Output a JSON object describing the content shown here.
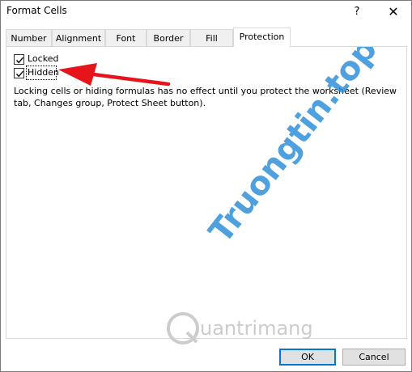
{
  "window": {
    "title": "Format Cells",
    "help_label": "?",
    "close_label": "✕"
  },
  "tabs": [
    {
      "label": "Number",
      "active": false
    },
    {
      "label": "Alignment",
      "active": false
    },
    {
      "label": "Font",
      "active": false
    },
    {
      "label": "Border",
      "active": false
    },
    {
      "label": "Fill",
      "active": false
    },
    {
      "label": "Protection",
      "active": true
    }
  ],
  "protection": {
    "locked": {
      "label": "Locked",
      "checked": true
    },
    "hidden": {
      "label": "Hidden",
      "checked": true
    },
    "info_text": "Locking cells or hiding formulas has no effect until you protect the worksheet (Review tab, Changes group, Protect Sheet button)."
  },
  "buttons": {
    "ok_label": "OK",
    "cancel_label": "Cancel"
  },
  "watermarks": {
    "vertical_text": "Truongtin.top",
    "bottom_text": "uantrimang"
  },
  "colors": {
    "accent": "#0078d7",
    "arrow": "#e8141c",
    "watermark_blue": "#2f8fd8",
    "watermark_orange": "#f39a3a",
    "watermark_gray": "#cccccc"
  }
}
